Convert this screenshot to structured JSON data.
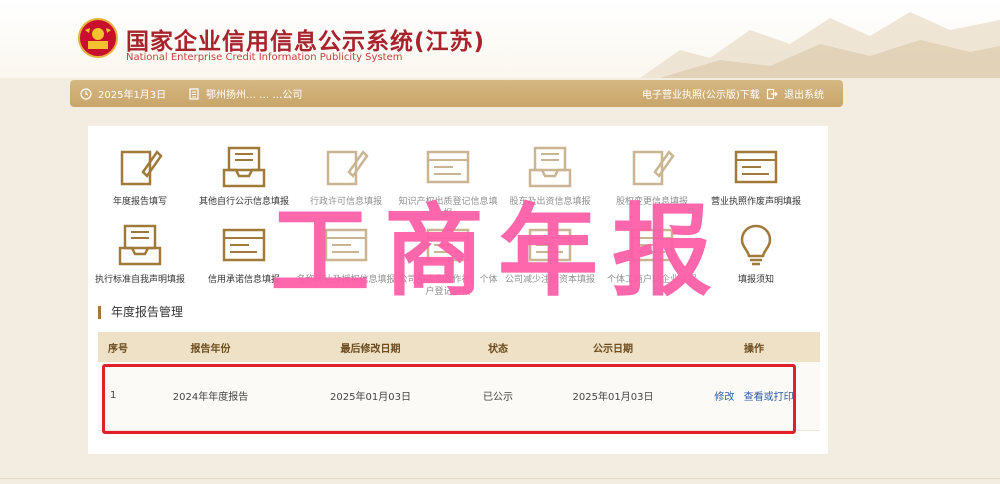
{
  "header": {
    "title_cn": "国家企业信用信息公示系统(江苏)",
    "title_en": "National Enterprise Credit Information Publicity System"
  },
  "navbar": {
    "date": "2025年1月3日",
    "company": "鄂州扬州… … …公司",
    "license_download": "电子营业执照(公示版)下载",
    "logout": "退出系统"
  },
  "tiles": [
    {
      "label": "年度报告填写",
      "icon": "pencil-doc-icon"
    },
    {
      "label": "其他自行公示信息填报",
      "icon": "inbox-doc-icon"
    },
    {
      "label": "行政许可信息填报",
      "icon": "pencil-doc-icon"
    },
    {
      "label": "知识产权出质登记信息填报",
      "icon": "window-doc-icon"
    },
    {
      "label": "股东及出资信息填报",
      "icon": "inbox-doc-icon"
    },
    {
      "label": "股权变更信息填报",
      "icon": "pencil-doc-icon"
    },
    {
      "label": "营业执照作废声明填报",
      "icon": "window-doc-icon"
    },
    {
      "label": "执行标准自我声明填报",
      "icon": "inbox-doc-icon"
    },
    {
      "label": "信用承诺信息填报",
      "icon": "window-doc-icon"
    },
    {
      "label": "名称转让及授权信息填报",
      "icon": "window-doc-icon"
    },
    {
      "label": "公司和农专合作社、个体户登记填报",
      "icon": "window-doc-icon"
    },
    {
      "label": "公司减少注册资本填报",
      "icon": "window-doc-icon"
    },
    {
      "label": "个体工商户转企业填报",
      "icon": "window-doc-icon"
    },
    {
      "label": "填报须知",
      "icon": "lightbulb-icon"
    }
  ],
  "section_title": "年度报告管理",
  "table": {
    "headers": [
      "序号",
      "报告年份",
      "最后修改日期",
      "状态",
      "公示日期",
      "操作"
    ],
    "rows": [
      {
        "index": "1",
        "year": "2024年年度报告",
        "modified": "2025年01月03日",
        "status": "已公示",
        "published": "2025年01月03日",
        "edit": "修改",
        "view": "查看或打印"
      }
    ]
  },
  "watermark": "工商年报",
  "colors": {
    "brand_red": "#a8232c",
    "nav_gold": "#c8a56a",
    "watermark_pink": "#ff5fa8",
    "highlight_red": "#e0202a",
    "link_blue": "#2d5ca3"
  }
}
